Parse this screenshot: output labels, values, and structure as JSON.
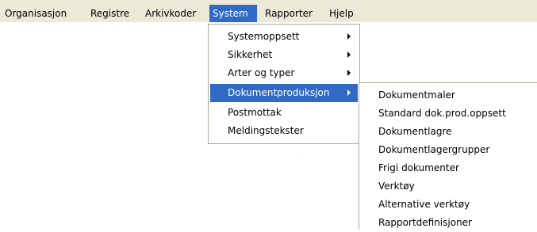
{
  "menubar": {
    "items": [
      {
        "label": "Organisasjon"
      },
      {
        "label": "Registre"
      },
      {
        "label": "Arkivkoder"
      },
      {
        "label": "System"
      },
      {
        "label": "Rapporter"
      },
      {
        "label": "Hjelp"
      }
    ]
  },
  "system_menu": {
    "items": [
      {
        "label": "Systemoppsett",
        "has_submenu": true
      },
      {
        "label": "Sikkerhet",
        "has_submenu": true
      },
      {
        "label": "Arter og typer",
        "has_submenu": true
      },
      {
        "label": "Dokumentproduksjon",
        "has_submenu": true
      },
      {
        "label": "Postmottak",
        "has_submenu": false
      },
      {
        "label": "Meldingstekster",
        "has_submenu": false
      }
    ]
  },
  "dokumentproduksjon_submenu": {
    "items": [
      {
        "label": "Dokumentmaler"
      },
      {
        "label": "Standard dok.prod.oppsett"
      },
      {
        "label": "Dokumentlagre"
      },
      {
        "label": "Dokumentlagergrupper"
      },
      {
        "label": "Frigi dokumenter"
      },
      {
        "label": "Verktøy"
      },
      {
        "label": "Alternative verktøy"
      },
      {
        "label": "Rapportdefinisjoner"
      }
    ]
  },
  "colors": {
    "menubar_background": "#ece9d8",
    "highlight": "#316ac5",
    "menu_border": "#aca899"
  }
}
